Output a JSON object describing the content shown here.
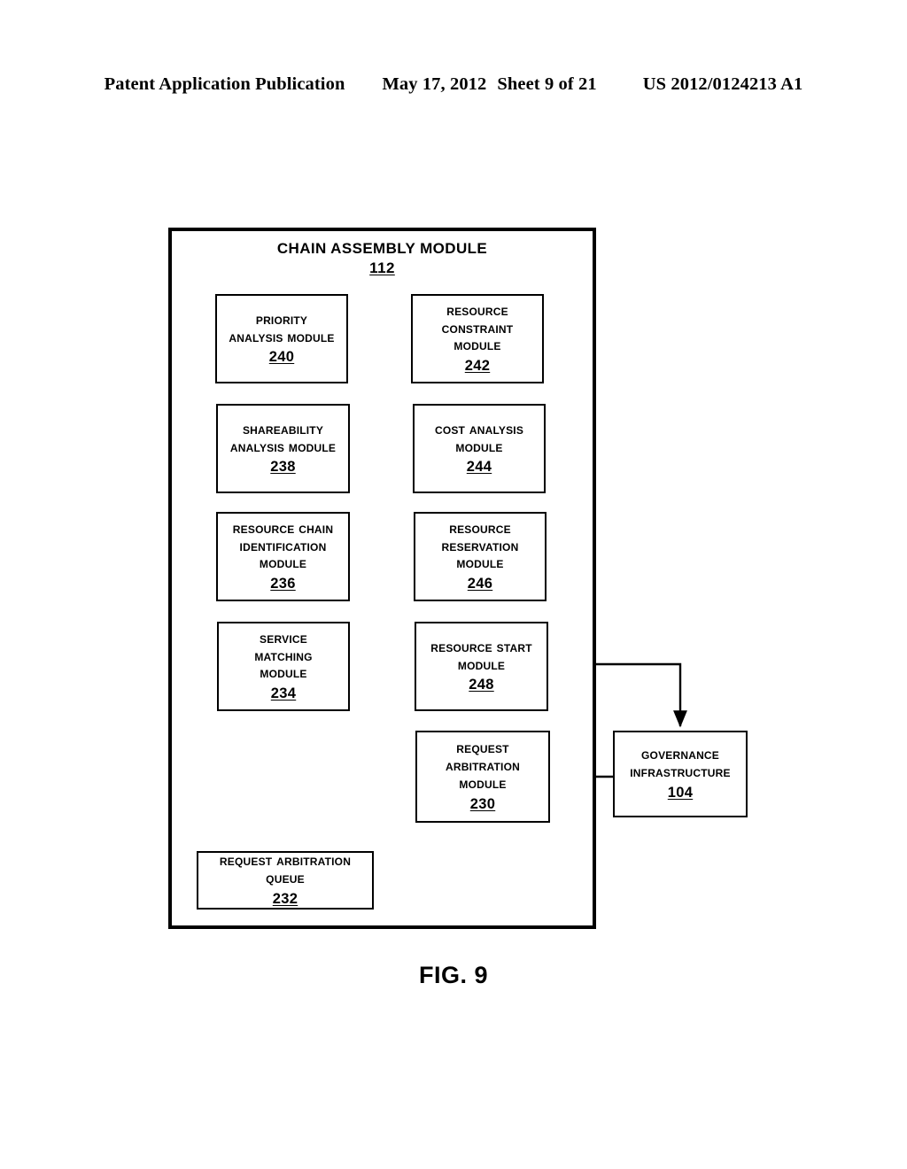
{
  "header": {
    "publication": "Patent Application Publication",
    "date": "May 17, 2012",
    "sheet": "Sheet 9 of 21",
    "patent_number": "US 2012/0124213 A1"
  },
  "figure": {
    "caption": "FIG. 9",
    "container": {
      "title": "CHAIN ASSEMBLY MODULE",
      "ref": "112"
    },
    "nodes": [
      {
        "id": "240",
        "lines": [
          "PRIORITY",
          "ANALYSIS MODULE"
        ],
        "ref": "240"
      },
      {
        "id": "242",
        "lines": [
          "RESOURCE",
          "CONSTRAINT",
          "MODULE"
        ],
        "ref": "242"
      },
      {
        "id": "238",
        "lines": [
          "SHAREABILITY",
          "ANALYSIS MODULE"
        ],
        "ref": "238"
      },
      {
        "id": "244",
        "lines": [
          "COST ANALYSIS",
          "MODULE"
        ],
        "ref": "244"
      },
      {
        "id": "236",
        "lines": [
          "RESOURCE CHAIN",
          "IDENTIFICATION",
          "MODULE"
        ],
        "ref": "236"
      },
      {
        "id": "246",
        "lines": [
          "RESOURCE",
          "RESERVATION",
          "MODULE"
        ],
        "ref": "246"
      },
      {
        "id": "234",
        "lines": [
          "SERVICE",
          "MATCHING",
          "MODULE"
        ],
        "ref": "234"
      },
      {
        "id": "248",
        "lines": [
          "RESOURCE START",
          "MODULE"
        ],
        "ref": "248"
      },
      {
        "id": "230",
        "lines": [
          "REQUEST",
          "ARBITRATION",
          "MODULE"
        ],
        "ref": "230"
      },
      {
        "id": "232",
        "lines": [
          "REQUEST ARBITRATION",
          "QUEUE"
        ],
        "ref": "232"
      },
      {
        "id": "104",
        "lines": [
          "GOVERNANCE",
          "INFRASTRUCTURE"
        ],
        "ref": "104"
      }
    ],
    "connections": [
      {
        "from": "240",
        "to": "242",
        "kind": "arrow"
      },
      {
        "from": "242",
        "to": "244",
        "kind": "arrow"
      },
      {
        "from": "244",
        "to": "246",
        "kind": "arrow"
      },
      {
        "from": "246",
        "to": "248",
        "kind": "arrow"
      },
      {
        "from": "248",
        "to": "230",
        "kind": "arrow"
      },
      {
        "from": "248",
        "to": "104",
        "kind": "arrow"
      },
      {
        "from": "104",
        "to": "230",
        "kind": "arrow"
      },
      {
        "from": "230",
        "to": "234",
        "kind": "arrow"
      },
      {
        "from": "230",
        "to": "232",
        "kind": "arrow"
      },
      {
        "from": "232",
        "to": "230",
        "kind": "arrow"
      },
      {
        "from": "234",
        "to": "236",
        "kind": "arrow"
      },
      {
        "from": "236",
        "to": "238",
        "kind": "arrow"
      },
      {
        "from": "238",
        "to": "240",
        "kind": "arrow"
      }
    ]
  }
}
